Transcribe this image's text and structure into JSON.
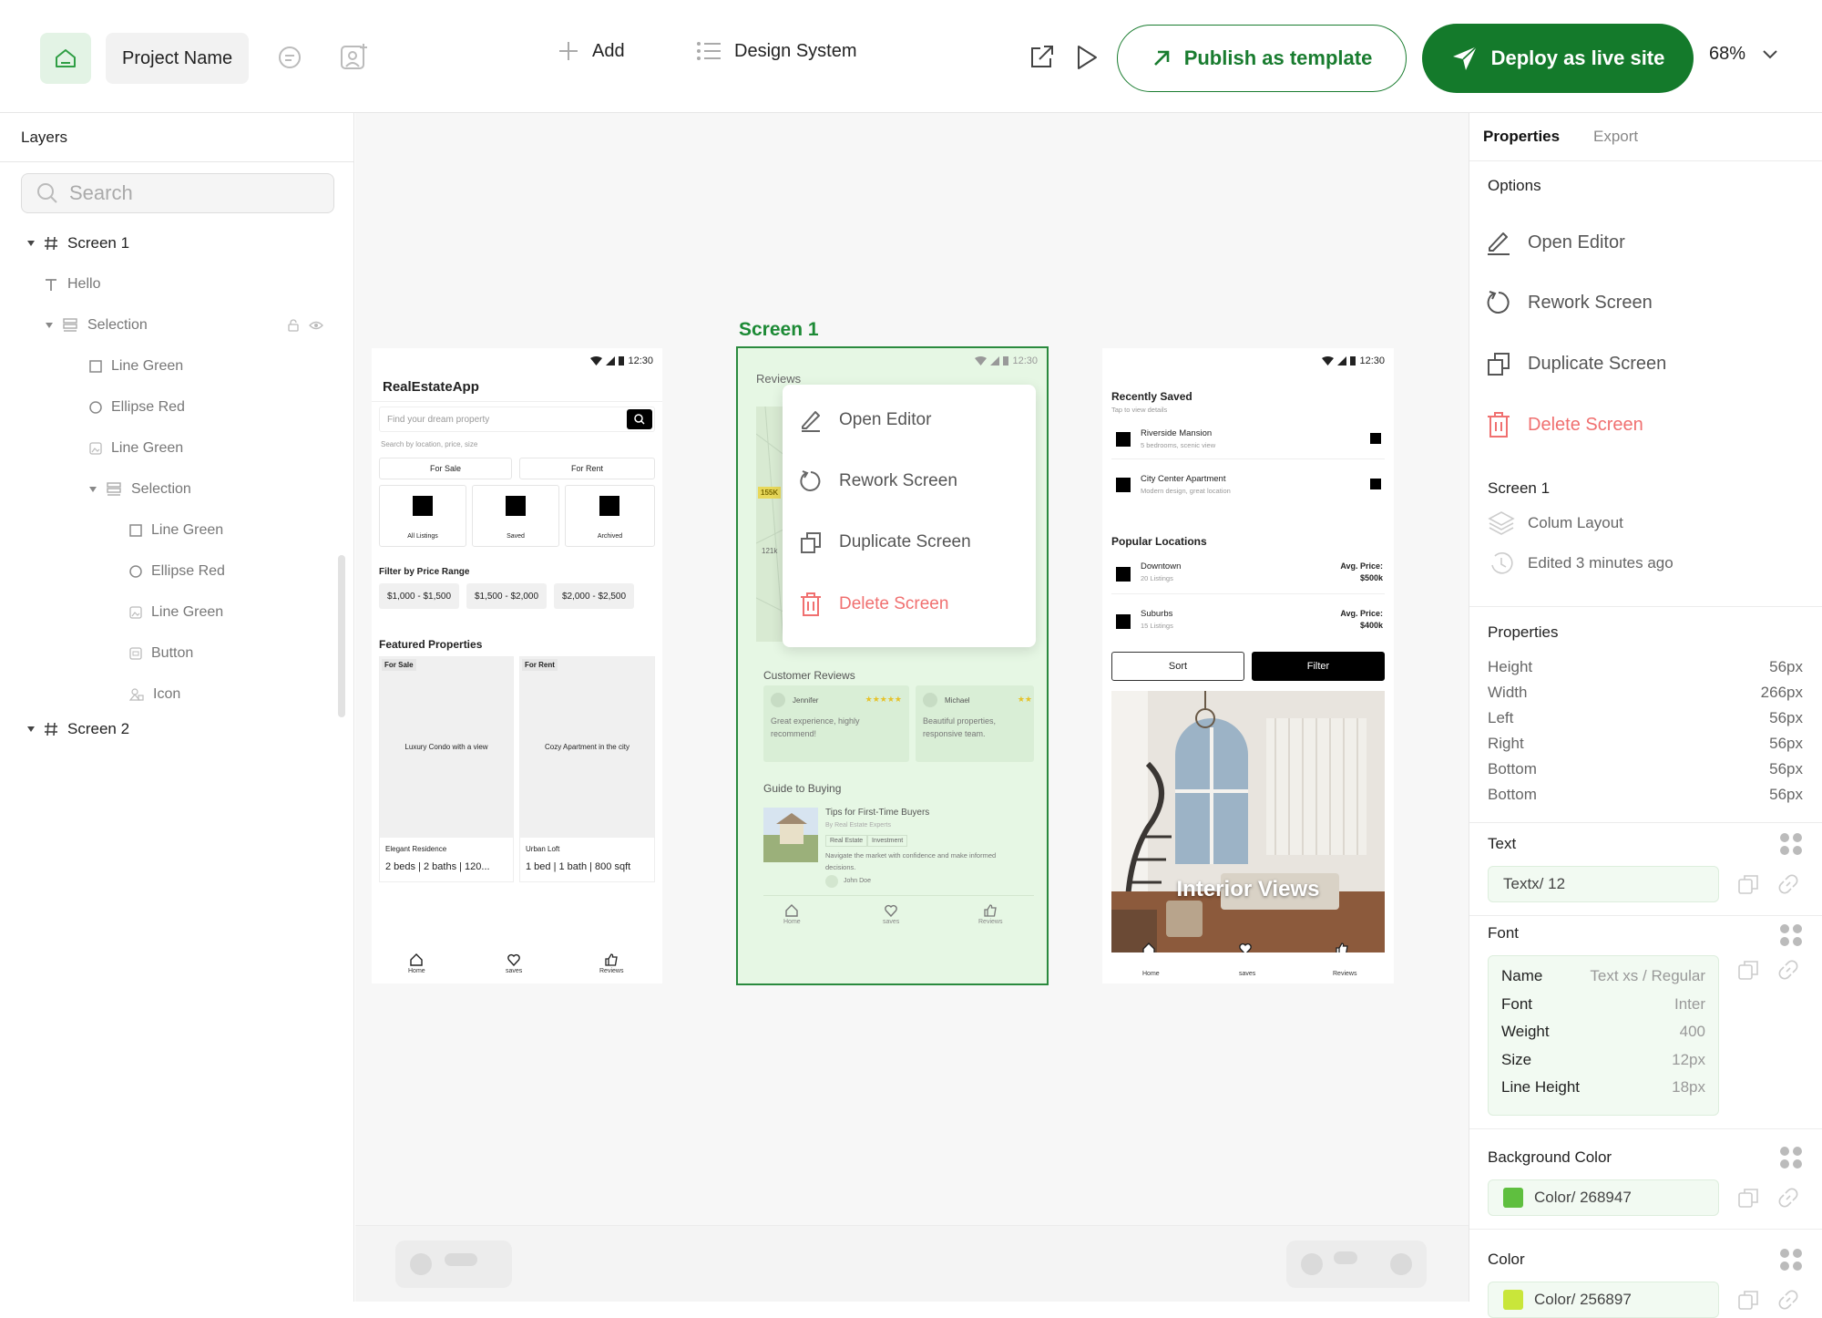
{
  "topbar": {
    "project_name": "Project Name",
    "add_label": "Add",
    "design_system_label": "Design System",
    "publish_label": "Publish as template",
    "deploy_label": "Deploy as live site",
    "zoom": "68%"
  },
  "layers": {
    "title": "Layers",
    "search_placeholder": "Search",
    "items": [
      {
        "label": "Screen 1",
        "icon": "hash-icon"
      },
      {
        "label": "Hello",
        "icon": "text-icon"
      },
      {
        "label": "Selection",
        "icon": "selection-icon"
      },
      {
        "label": "Line Green",
        "icon": "square-icon"
      },
      {
        "label": "Ellipse Red",
        "icon": "circle-icon"
      },
      {
        "label": "Line Green",
        "icon": "image-icon"
      },
      {
        "label": "Selection",
        "icon": "selection-icon"
      },
      {
        "label": "Line Green",
        "icon": "square-icon"
      },
      {
        "label": "Ellipse Red",
        "icon": "circle-icon"
      },
      {
        "label": "Line Green",
        "icon": "image-icon"
      },
      {
        "label": "Button",
        "icon": "button-icon"
      },
      {
        "label": "Icon",
        "icon": "shapes-icon"
      },
      {
        "label": "Screen 2",
        "icon": "hash-icon"
      }
    ]
  },
  "status_time": "12:30",
  "screen_left": {
    "app_title": "RealEstateApp",
    "search_placeholder": "Find your dream property",
    "search_hint": "Search by location, price, size",
    "tab_sale": "For Sale",
    "tab_rent": "For Rent",
    "cats": [
      "All Listings",
      "Saved",
      "Archived"
    ],
    "filter_title": "Filter by Price Range",
    "ranges": [
      "$1,000 - $1,500",
      "$1,500 - $2,000",
      "$2,000 - $2,500"
    ],
    "featured_title": "Featured Properties",
    "cards": [
      {
        "tag": "For Sale",
        "caption": "Luxury Condo with a view",
        "name": "Elegant Residence",
        "details": "2 beds | 2 baths | 120..."
      },
      {
        "tag": "For Rent",
        "caption": "Cozy Apartment in the city",
        "name": "Urban Loft",
        "details": "1 bed | 1 bath | 800 sqft"
      }
    ],
    "nav": [
      "Home",
      "saves",
      "Reviews"
    ]
  },
  "screen_mid": {
    "frame_label": "Screen 1",
    "reviews_title": "Reviews",
    "map_tags": [
      "155K",
      "121k"
    ],
    "menu": [
      "Open Editor",
      "Rework Screen",
      "Duplicate Screen",
      "Delete Screen"
    ],
    "customer_reviews_title": "Customer Reviews",
    "reviews": [
      {
        "name": "Jennifer",
        "stars": "★★★★★",
        "text": "Great experience, highly recommend!"
      },
      {
        "name": "Michael",
        "stars": "★★",
        "text": "Beautiful properties, responsive team."
      }
    ],
    "guide_title": "Guide to Buying",
    "article": {
      "title": "Tips for First-Time Buyers",
      "byline": "By Real Estate Experts",
      "tags": [
        "Real Estate",
        "Investment"
      ],
      "text": "Navigate the market with confidence and make informed decisions.",
      "author": "John Doe"
    },
    "nav": [
      "Home",
      "saves",
      "Reviews"
    ]
  },
  "screen_right": {
    "recent_title": "Recently Saved",
    "recent_sub": "Tap to view details",
    "recent": [
      {
        "name": "Riverside Mansion",
        "desc": "5 bedrooms, scenic view"
      },
      {
        "name": "City Center Apartment",
        "desc": "Modern design, great location"
      }
    ],
    "popular_title": "Popular Locations",
    "popular": [
      {
        "name": "Downtown",
        "count": "20 Listings",
        "label": "Avg. Price:",
        "price": "$500k"
      },
      {
        "name": "Suburbs",
        "count": "15 Listings",
        "label": "Avg. Price:",
        "price": "$400k"
      }
    ],
    "sort_label": "Sort",
    "filter_label": "Filter",
    "image_caption": "Interior Views",
    "nav": [
      "Home",
      "saves",
      "Reviews"
    ]
  },
  "props": {
    "tab_properties": "Properties",
    "tab_export": "Export",
    "options_title": "Options",
    "options": [
      "Open Editor",
      "Rework Screen",
      "Duplicate Screen",
      "Delete Screen"
    ],
    "screen_title": "Screen 1",
    "layout": "Colum Layout",
    "edited": "Edited 3 minutes ago",
    "properties_title": "Properties",
    "dims": [
      {
        "label": "Height",
        "value": "56px"
      },
      {
        "label": "Width",
        "value": "266px"
      },
      {
        "label": "Left",
        "value": "56px"
      },
      {
        "label": "Right",
        "value": "56px"
      },
      {
        "label": "Bottom",
        "value": "56px"
      },
      {
        "label": "Bottom",
        "value": "56px"
      }
    ],
    "text_title": "Text",
    "text_value": "Textx/  12",
    "font_title": "Font",
    "font_rows": [
      {
        "label": "Name",
        "value": "Text xs / Regular"
      },
      {
        "label": "Font",
        "value": "Inter"
      },
      {
        "label": "Weight",
        "value": "400"
      },
      {
        "label": "Size",
        "value": "12px"
      },
      {
        "label": "Line Height",
        "value": "18px"
      }
    ],
    "bg_title": "Background Color",
    "bg_value": "Color/ 268947",
    "bg_swatch": "#5fbf3f",
    "color_title": "Color",
    "color_value": "Color/ 256897",
    "color_swatch": "#c9e63a"
  },
  "colors": {
    "brand_green": "#147a2b",
    "delete_red": "#f07070",
    "selection_green": "#e6f7e4"
  }
}
